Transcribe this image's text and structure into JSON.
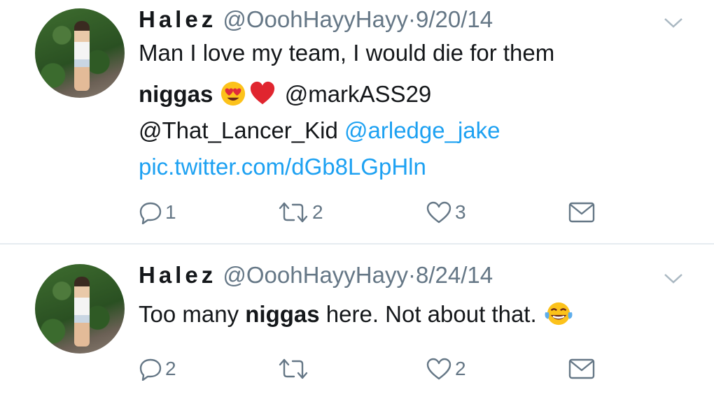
{
  "tweets": [
    {
      "name": "Halez",
      "handle": "@OoohHayyHayy",
      "separator": "·",
      "date": "9/20/14",
      "lines": {
        "l1": "Man I love my team, I would die for them",
        "l2_bold": "niggas",
        "l2_mention": "@markASS29",
        "l3_mention_plain": "@That_Lancer_Kid",
        "l3_mention_link": "@arledge_jake",
        "l4_link": "pic.twitter.com/dGb8LGpHln"
      },
      "emojis": [
        "heart-eyes-emoji",
        "red-heart-emoji"
      ],
      "replies": "1",
      "retweets": "2",
      "likes": "3"
    },
    {
      "name": "Halez",
      "handle": "@OoohHayyHayy",
      "separator": "·",
      "date": "8/24/14",
      "lines": {
        "l1_before": "Too many ",
        "l1_bold": "niggas",
        "l1_after": " here. Not about that. "
      },
      "emojis": [
        "tears-of-joy-emoji"
      ],
      "replies": "2",
      "retweets": "",
      "likes": "2"
    }
  ],
  "colors": {
    "text": "#14171a",
    "meta": "#657786",
    "link": "#1da1f2",
    "divider": "#e6ecf0"
  }
}
